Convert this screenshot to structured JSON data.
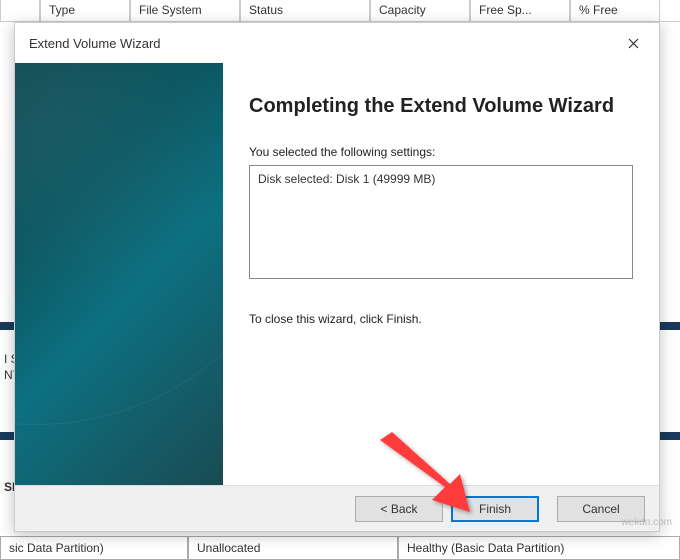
{
  "bg": {
    "headers": [
      "Type",
      "File System",
      "Status",
      "Capacity",
      "Free Sp...",
      "% Free"
    ],
    "label1": "I S",
    "label2": "NT",
    "label3": "SD",
    "footer": [
      "sic Data Partition)",
      "Unallocated",
      "Healthy (Basic Data Partition)"
    ]
  },
  "dialog": {
    "title": "Extend Volume Wizard",
    "heading": "Completing the Extend Volume Wizard",
    "subtext": "You selected the following settings:",
    "settings": "Disk selected: Disk 1 (49999 MB)",
    "close_text": "To close this wizard, click Finish.",
    "buttons": {
      "back": "< Back",
      "finish": "Finish",
      "cancel": "Cancel"
    }
  },
  "watermark": "wekdn.com"
}
